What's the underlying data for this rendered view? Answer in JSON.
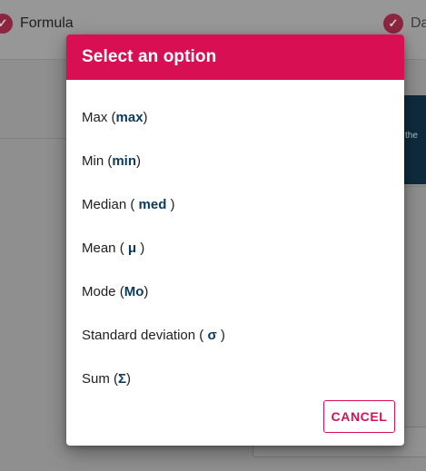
{
  "background": {
    "steps": [
      {
        "label": "Formula",
        "icon": "check-icon"
      },
      {
        "label": "Da",
        "icon": "check-icon"
      }
    ],
    "panel_text": "the"
  },
  "dialog": {
    "title": "Select an option",
    "options": [
      {
        "label": "Max",
        "symbol": "max",
        "open": " (",
        "close": ")"
      },
      {
        "label": "Min",
        "symbol": "min",
        "open": " (",
        "close": ")"
      },
      {
        "label": "Median",
        "symbol": "med",
        "open": " ( ",
        "close": " )"
      },
      {
        "label": "Mean",
        "symbol": "μ",
        "open": " ( ",
        "close": " )"
      },
      {
        "label": "Mode",
        "symbol": "Mo",
        "open": " (",
        "close": ")"
      },
      {
        "label": "Standard deviation",
        "symbol": "σ",
        "open": " ( ",
        "close": " )"
      },
      {
        "label": "Sum",
        "symbol": "Σ",
        "open": " (",
        "close": ")"
      }
    ],
    "cancel_label": "CANCEL"
  },
  "colors": {
    "accent": "#d90f53",
    "symbol": "#0c3b5d",
    "overlay": "#8f8f8f"
  }
}
